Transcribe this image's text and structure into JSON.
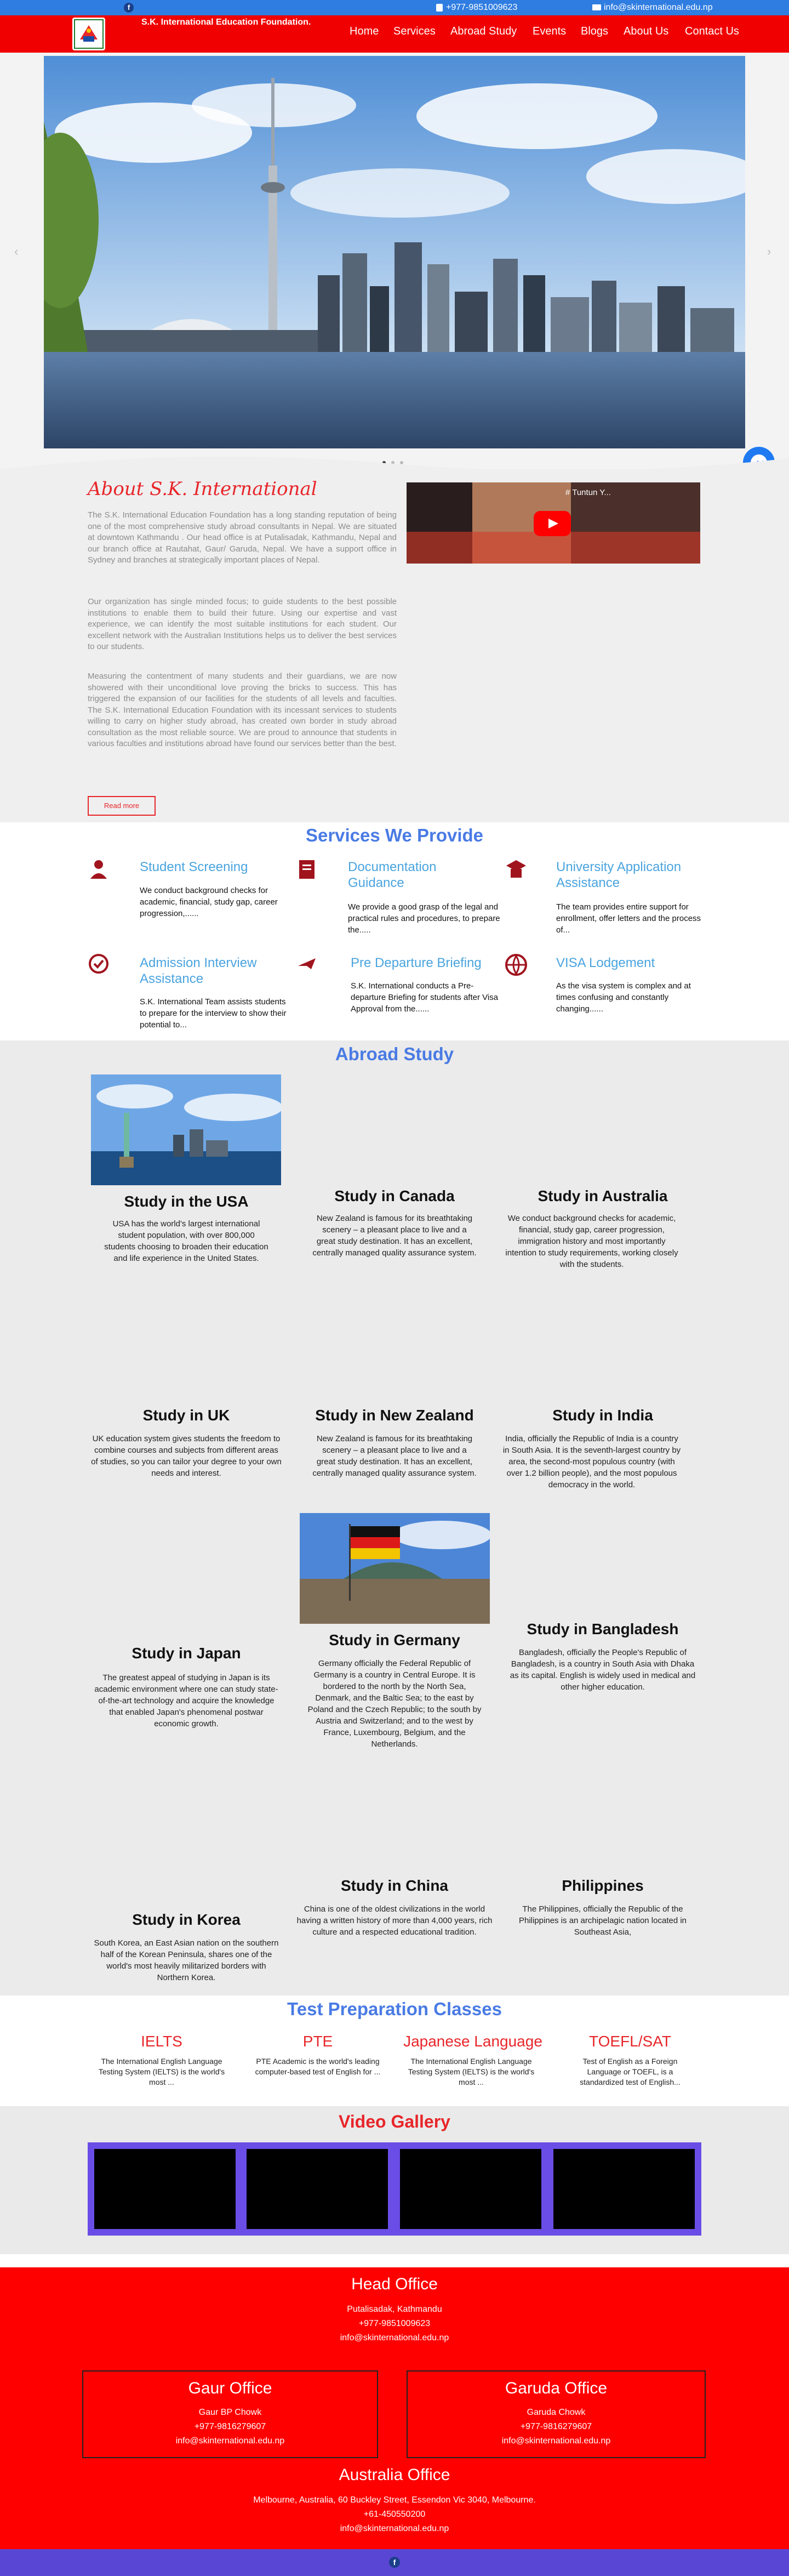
{
  "topbar": {
    "phone": "+977-9851009623",
    "email": "info@skinternational.edu.np"
  },
  "brand": {
    "name": "S.K. International Education Foundation."
  },
  "nav": [
    "Home",
    "Services",
    "Abroad Study",
    "Events",
    "Blogs",
    "About Us",
    "Contact Us"
  ],
  "about": {
    "title": "About S.K. International",
    "p1": "The S.K. International Education Foundation has a long standing reputation of being one of the most comprehensive study abroad consultants in Nepal. We are situated at downtown Kathmandu . Our head office is at Putalisadak, Kathmandu, Nepal and our branch office at Rautahat, Gaur/ Garuda, Nepal. We have a support office in Sydney and branches at strategically important places of Nepal.",
    "p2": "Our organization has single minded focus; to guide students to the best possible institutions to enable them to build their future. Using our expertise and vast experience, we can identify the most suitable institutions for each student. Our excellent network with the Australian Institutions helps us to deliver the best services to our students.",
    "p3": "Measuring the contentment of many students and their guardians, we are now showered with their unconditional love proving the bricks to success. This has triggered the expansion of our facilities for the students of all levels and faculties. The S.K. International Education Foundation with its incessant services to students willing to carry on higher study abroad, has created own border in study abroad consultation as the most reliable source. We are proud to announce that students in various faculties and institutions abroad have found our services better than the best.",
    "read_more": "Read more",
    "video_title": "# Tuntun Y..."
  },
  "services": {
    "title": "Services We Provide",
    "items": [
      {
        "title": "Student Screening",
        "text": "We conduct background checks for academic, financial, study gap, career progression,......"
      },
      {
        "title": "Documentation Guidance",
        "text": "We provide a good grasp of the legal and practical rules and procedures, to prepare the....."
      },
      {
        "title": "University Application Assistance",
        "text": "The team provides entire support for enrollment, offer letters and the process of..."
      },
      {
        "title": "Admission Interview Assistance",
        "text": "S.K. International Team assists students to prepare for the interview to show their potential to..."
      },
      {
        "title": "Pre Departure Briefing",
        "text": "S.K. International conducts a Pre-departure Briefing for students after Visa Approval from the......"
      },
      {
        "title": "VISA Lodgement",
        "text": "As the visa system is complex and at times confusing and constantly changing......"
      }
    ]
  },
  "abroad": {
    "title": "Abroad Study",
    "items": [
      {
        "title": "Study in the USA",
        "text": "USA has the world's largest international student population, with over 800,000 students choosing to broaden their education and life experience in the United States."
      },
      {
        "title": "Study in Canada",
        "text": "New Zealand is famous for its breathtaking scenery – a pleasant place to live and a great study destination. It has an excellent, centrally managed quality assurance system."
      },
      {
        "title": "Study in Australia",
        "text": "We conduct background checks for academic, financial, study gap, career progression, immigration history and most importantly intention to study requirements, working closely with the students."
      },
      {
        "title": "Study in UK",
        "text": "UK education system gives students the freedom to combine courses and subjects from different areas of studies, so you can tailor your degree to your own needs and interest."
      },
      {
        "title": "Study in New Zealand",
        "text": "New Zealand is famous for its breathtaking scenery – a pleasant place to live and a great study destination. It has an excellent, centrally managed quality assurance system."
      },
      {
        "title": "Study in India",
        "text": "India, officially the Republic of India is a country in South Asia. It is the seventh-largest country by area, the second-most populous country (with over 1.2 billion people), and the most populous democracy in the world."
      },
      {
        "title": "Study in Japan",
        "text": "The greatest appeal of studying in Japan is its academic environment where one can study state-of-the-art technology and acquire the knowledge that enabled Japan's phenomenal postwar economic growth."
      },
      {
        "title": "Study in Germany",
        "text": "Germany officially the Federal Republic of Germany is a country in Central Europe. It is bordered to the north by the North Sea, Denmark, and the Baltic Sea; to the east by Poland and the Czech Republic; to the south by Austria and Switzerland; and to the west by France, Luxembourg, Belgium, and the Netherlands."
      },
      {
        "title": "Study in Bangladesh",
        "text": "Bangladesh, officially the People's Republic of Bangladesh, is a country in South Asia with Dhaka as its capital. English is widely used in medical and other higher education."
      },
      {
        "title": "Study in Korea",
        "text": "South Korea, an East Asian nation on the southern half of the Korean Peninsula, shares one of the world's most heavily militarized borders with Northern Korea."
      },
      {
        "title": "Study in China",
        "text": "China is one of the oldest civilizations in the world having a written history of more than 4,000 years, rich culture and a respected educational tradition."
      },
      {
        "title": "Philippines",
        "text": "The Philippines, officially the Republic of the Philippines is an archipelagic nation located in Southeast Asia,"
      }
    ]
  },
  "tests": {
    "title": "Test Preparation Classes",
    "items": [
      {
        "title": "IELTS",
        "text": "The International English Language Testing System (IELTS) is the world's most ..."
      },
      {
        "title": "PTE",
        "text": "PTE Academic is the world's leading computer-based test of English for ..."
      },
      {
        "title": "Japanese Language",
        "text": "The International English Language Testing System (IELTS) is the world's most ..."
      },
      {
        "title": "TOEFL/SAT",
        "text": "Test of English as a Foreign Language or TOEFL, is a standardized test of English..."
      }
    ]
  },
  "video": {
    "title": "Video Gallery"
  },
  "offices": {
    "head": {
      "title": "Head Office",
      "address": "Putalisadak, Kathmandu",
      "phone": "+977-9851009623",
      "email": "info@skinternational.edu.np"
    },
    "gaur": {
      "title": "Gaur Office",
      "address": "Gaur BP Chowk",
      "phone": "+977-9816279607",
      "email": "info@skinternational.edu.np"
    },
    "garuda": {
      "title": "Garuda Office",
      "address": "Garuda Chowk",
      "phone": "+977-9816279607",
      "email": "info@skinternational.edu.np"
    },
    "australia": {
      "title": "Australia Office",
      "address": "Melbourne, Australia, 60 Buckley Street, Essendon Vic 3040, Melbourne.",
      "phone": "+61-450550200",
      "email": "info@skinternational.edu.np"
    }
  },
  "colors": {
    "topbar": "#2f7de1",
    "nav": "#f00000",
    "accent_blue": "#4a7be4",
    "accent_red": "#e8262a",
    "gallery_border": "#6a4de6"
  },
  "icons": [
    "facebook-icon",
    "phone-icon",
    "mail-icon",
    "messenger-icon",
    "home-icon"
  ]
}
